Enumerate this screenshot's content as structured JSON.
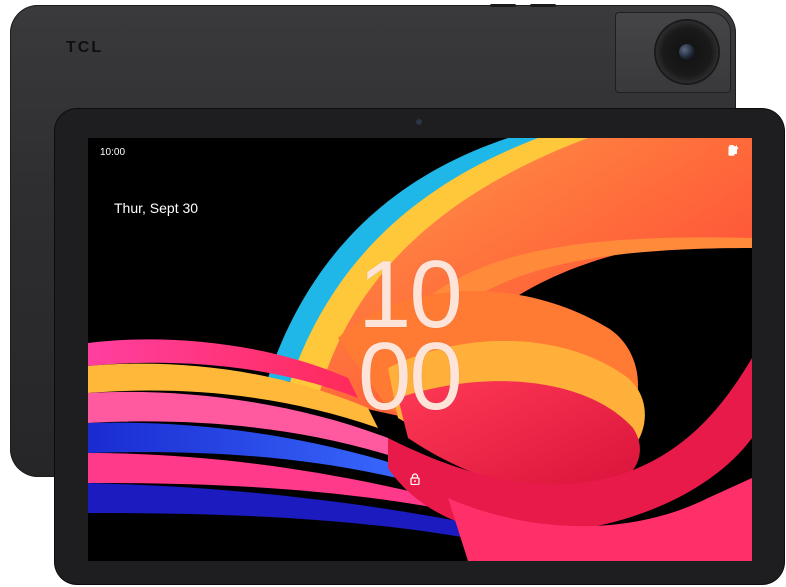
{
  "device": {
    "brand": "TCL"
  },
  "lockscreen": {
    "status_time": "10:00",
    "date": "Thur, Sept 30",
    "clock_hours": "10",
    "clock_minutes": "00"
  },
  "icons": [
    "wifi-icon",
    "signal-icon",
    "battery-icon",
    "lock-icon",
    "rear-camera-icon",
    "front-camera-icon"
  ],
  "colors": {
    "body": "#2e2e30",
    "bezel": "#1e1e20",
    "clock_text": "#fde3d8"
  }
}
